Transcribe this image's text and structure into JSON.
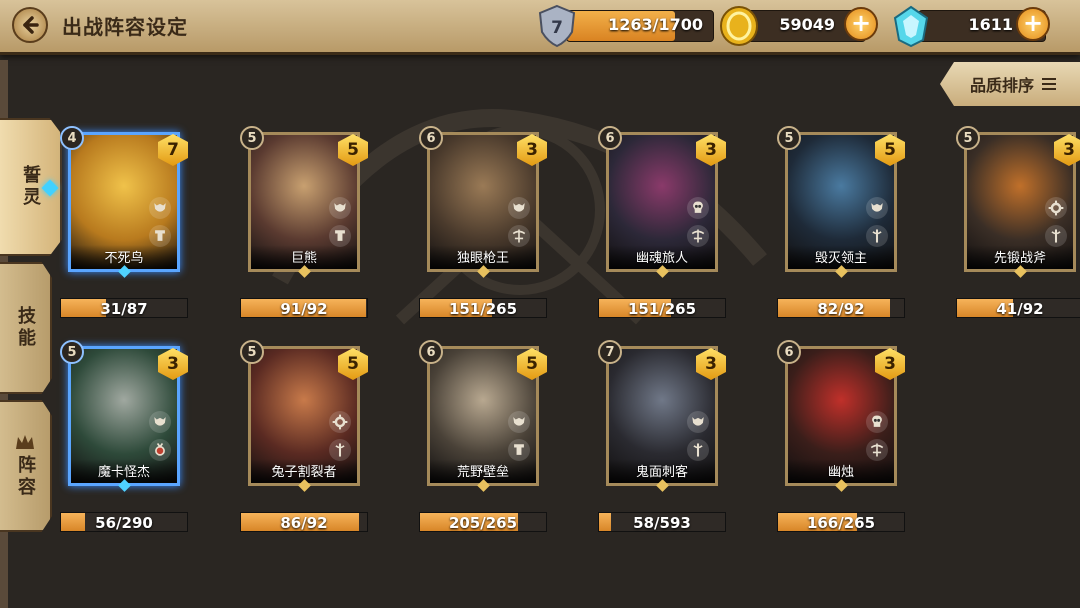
{
  "header": {
    "title": "出战阵容设定",
    "stamina": {
      "level": "7",
      "value": "1263/1700",
      "fill": 0.743
    },
    "gold": {
      "value": "59049"
    },
    "gems": {
      "value": "1611"
    }
  },
  "sort_label": "品质排序",
  "tabs": [
    {
      "label": "誓灵",
      "active": true
    },
    {
      "label": "技能",
      "active": false
    },
    {
      "label": "阵容",
      "active": false
    }
  ],
  "colors": {
    "accent_orange": "#e38a19",
    "rare_blue": "#5aa5ff",
    "frame_bronze": "#a58a5a"
  },
  "cards": [
    {
      "name": "不死鸟",
      "level": "4",
      "stars": "7",
      "progress": "31/87",
      "fill": 0.356,
      "rarity": "blue",
      "palette": [
        "#b87a1e",
        "#f0c24a"
      ],
      "icons": [
        "beast-icon",
        "tower-icon"
      ]
    },
    {
      "name": "巨熊",
      "level": "5",
      "stars": "5",
      "progress": "91/92",
      "fill": 0.989,
      "rarity": "bronze",
      "palette": [
        "#5a3a30",
        "#c8a070"
      ],
      "icons": [
        "beast-icon",
        "tower-icon"
      ]
    },
    {
      "name": "独眼枪王",
      "level": "6",
      "stars": "3",
      "progress": "151/265",
      "fill": 0.57,
      "rarity": "bronze",
      "palette": [
        "#4a3a2c",
        "#9a7a56"
      ],
      "icons": [
        "beast-icon",
        "crossbow-icon"
      ]
    },
    {
      "name": "幽魂旅人",
      "level": "6",
      "stars": "3",
      "progress": "151/265",
      "fill": 0.57,
      "rarity": "bronze",
      "palette": [
        "#2c2838",
        "#8a3a6a"
      ],
      "icons": [
        "skull-icon",
        "crossbow-icon"
      ]
    },
    {
      "name": "毁灭领主",
      "level": "5",
      "stars": "5",
      "progress": "82/92",
      "fill": 0.891,
      "rarity": "bronze",
      "palette": [
        "#1e2a38",
        "#4a7aa0"
      ],
      "icons": [
        "beast-icon",
        "staff-icon"
      ]
    },
    {
      "name": "先锻战斧",
      "level": "5",
      "stars": "3",
      "progress": "41/92",
      "fill": 0.446,
      "rarity": "bronze",
      "palette": [
        "#3a2e26",
        "#c0702a"
      ],
      "icons": [
        "gear-icon",
        "staff-icon"
      ]
    },
    {
      "name": "魔卡怪杰",
      "level": "5",
      "stars": "3",
      "progress": "56/290",
      "fill": 0.193,
      "rarity": "blue",
      "palette": [
        "#2e4a3a",
        "#a0a8a0"
      ],
      "icons": [
        "beast-icon",
        "amulet-icon"
      ]
    },
    {
      "name": "兔子割裂者",
      "level": "5",
      "stars": "5",
      "progress": "86/92",
      "fill": 0.935,
      "rarity": "bronze",
      "palette": [
        "#5a2a22",
        "#c87a4a"
      ],
      "icons": [
        "gear-icon",
        "staff-icon"
      ]
    },
    {
      "name": "荒野壁垒",
      "level": "6",
      "stars": "5",
      "progress": "205/265",
      "fill": 0.774,
      "rarity": "bronze",
      "palette": [
        "#4a4238",
        "#b8a890"
      ],
      "icons": [
        "beast-icon",
        "tower-icon"
      ]
    },
    {
      "name": "鬼面刺客",
      "level": "7",
      "stars": "3",
      "progress": "58/593",
      "fill": 0.098,
      "rarity": "bronze",
      "palette": [
        "#2a2a30",
        "#707888"
      ],
      "icons": [
        "beast-icon",
        "staff-icon"
      ]
    },
    {
      "name": "幽烛",
      "level": "6",
      "stars": "3",
      "progress": "166/265",
      "fill": 0.626,
      "rarity": "bronze",
      "palette": [
        "#3a1e1a",
        "#c0302a"
      ],
      "icons": [
        "skull-icon",
        "crossbow-icon"
      ]
    }
  ]
}
